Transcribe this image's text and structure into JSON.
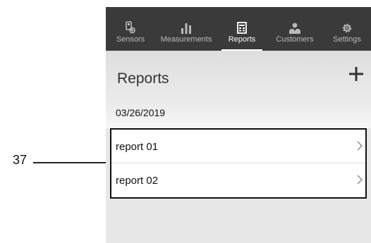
{
  "callout": {
    "number": "37"
  },
  "tabs": [
    {
      "label": "Sensors",
      "icon": "sensor-icon",
      "active": false
    },
    {
      "label": "Measurements",
      "icon": "bar-chart-icon",
      "active": false
    },
    {
      "label": "Reports",
      "icon": "report-icon",
      "active": true
    },
    {
      "label": "Customers",
      "icon": "customers-icon",
      "active": false
    },
    {
      "label": "Settings",
      "icon": "gear-icon",
      "active": false
    }
  ],
  "header": {
    "title": "Reports",
    "add_icon": "plus-icon"
  },
  "date_group": {
    "date": "03/26/2019"
  },
  "reports": [
    {
      "name": "report 01",
      "icon": "chevron-right-icon"
    },
    {
      "name": "report 02",
      "icon": "chevron-right-icon"
    }
  ],
  "colors": {
    "tabbar": "#3a3a3a",
    "active_tab": "#ffffff",
    "inactive_tab": "#b9b9b9",
    "background": "#e7e7e7"
  }
}
